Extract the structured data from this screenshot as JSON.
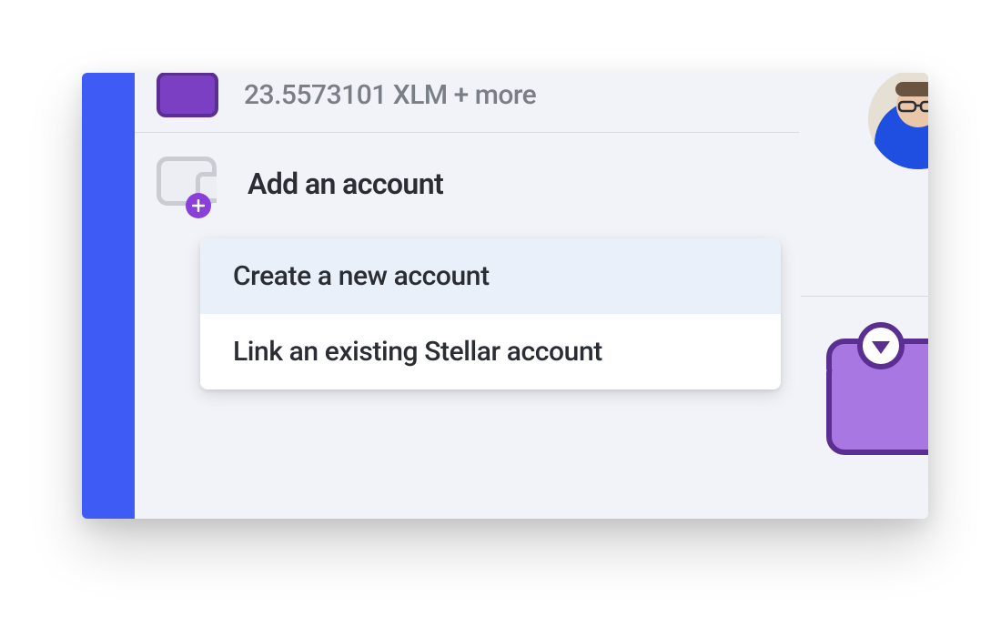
{
  "colors": {
    "sidebar": "#3e5bf6",
    "panel": "#f1f3f8",
    "accent_purple": "#8b3fd9",
    "wallet_purple": "#7b3fc3",
    "wallet_border": "#5b2f92",
    "text_primary": "#2a2d33",
    "text_muted": "#7a7f87",
    "hover_bg": "#eaf0f9"
  },
  "balance": {
    "text": "23.5573101 XLM + more"
  },
  "add_account": {
    "label": "Add an account"
  },
  "dropdown": {
    "items": [
      {
        "label": "Create a new account",
        "hover": true
      },
      {
        "label": "Link an existing Stellar account",
        "hover": false
      }
    ]
  }
}
